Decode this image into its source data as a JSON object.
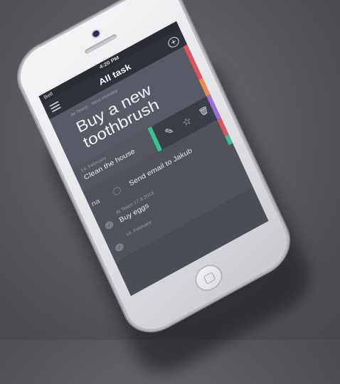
{
  "status": {
    "carrier": "Bell",
    "time": "4:20 PM"
  },
  "nav": {
    "title": "All task",
    "add_label": "+"
  },
  "tasks": [
    {
      "meta": "At Tesco · Next monday",
      "title": "Buy a new toothbrush"
    },
    {
      "meta": "14. February",
      "title": "Clean the house"
    },
    {
      "partial": "na",
      "title": "Send email to Jakub"
    },
    {
      "meta": "At Tesco   17.3.2013",
      "title": "Buy eggs"
    },
    {
      "meta": "14. February",
      "title": ""
    }
  ],
  "actions": {
    "edit": "✎",
    "favorite": "☆",
    "delete": "🗑"
  },
  "colors": {
    "red": "#e0525d",
    "orange": "#f08a4b",
    "purple": "#9a6fd6",
    "green": "#35c491"
  }
}
